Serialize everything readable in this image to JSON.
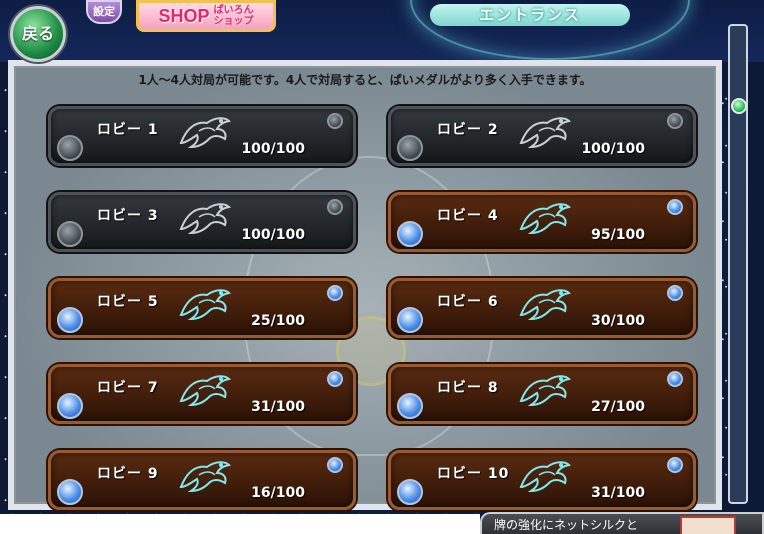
{
  "header": {
    "back_label": "戻る",
    "settings_label": "設定",
    "shop_label": "SHOP",
    "shop_sub_label": "ぱいろん\nショップ",
    "title": "エントランス"
  },
  "notice": "1人〜4人対局が可能です。4人で対局すると、ぱいメダルがより多く入手できます。",
  "lobbies": [
    {
      "name": "ロビー 1",
      "count": "100/100",
      "status": "full"
    },
    {
      "name": "ロビー 2",
      "count": "100/100",
      "status": "full"
    },
    {
      "name": "ロビー 3",
      "count": "100/100",
      "status": "full"
    },
    {
      "name": "ロビー 4",
      "count": "95/100",
      "status": "open"
    },
    {
      "name": "ロビー 5",
      "count": "25/100",
      "status": "open"
    },
    {
      "name": "ロビー 6",
      "count": "30/100",
      "status": "open"
    },
    {
      "name": "ロビー 7",
      "count": "31/100",
      "status": "open"
    },
    {
      "name": "ロビー 8",
      "count": "27/100",
      "status": "open"
    },
    {
      "name": "ロビー 9",
      "count": "16/100",
      "status": "open"
    },
    {
      "name": "ロビー 10",
      "count": "31/100",
      "status": "open"
    }
  ],
  "notification": {
    "text": "牌の強化にネットシルクと"
  },
  "icons": {
    "lobby_emblem": "phoenix-icon",
    "scroll_handle": "green-orb-icon"
  },
  "colors": {
    "full_lobby": "#15181b",
    "open_lobby": "#5a2b10",
    "accent_green": "#1d8a43",
    "shop_pink": "#e9246b"
  }
}
